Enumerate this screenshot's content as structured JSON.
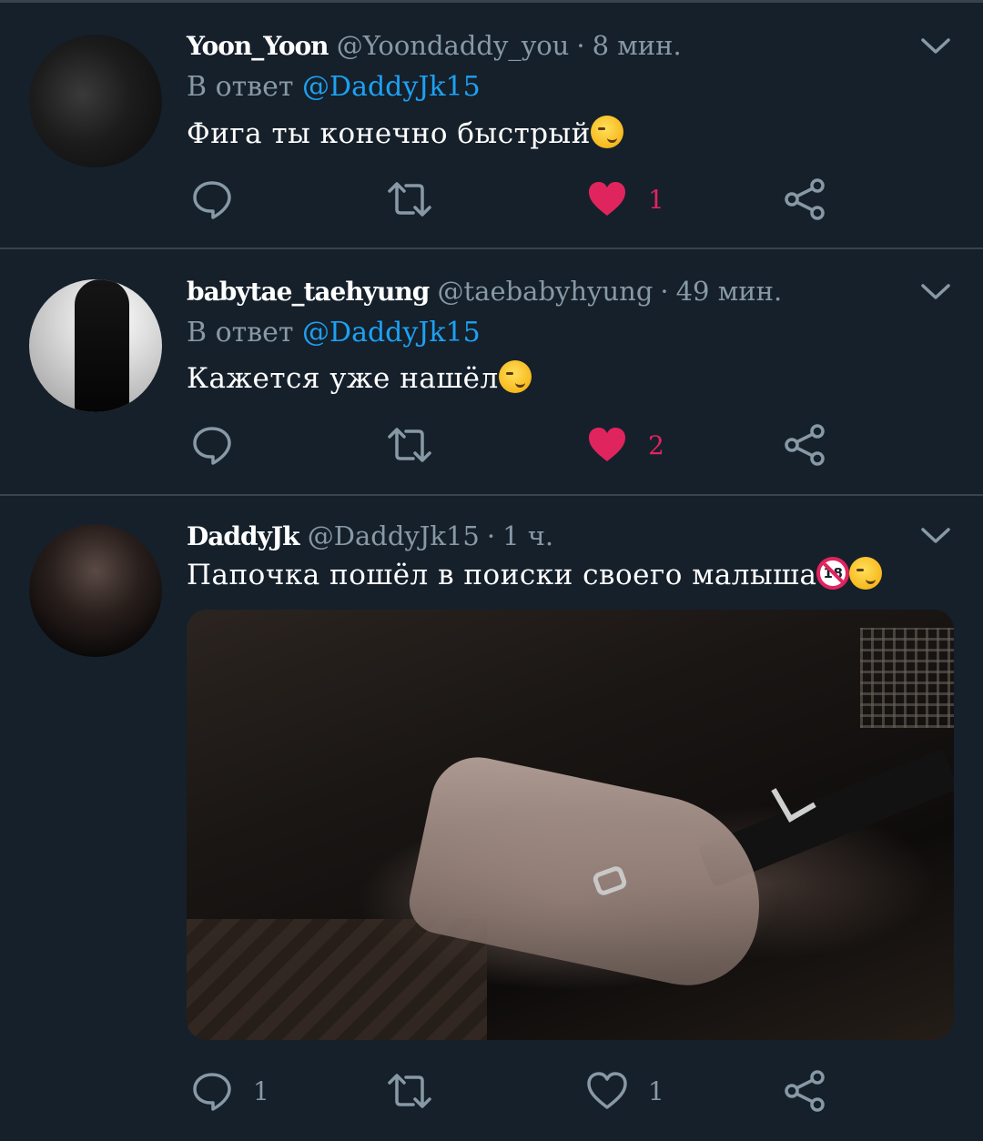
{
  "tweets": [
    {
      "display_name": "Yoon_Yoon",
      "handle": "@Yoondaddy_you",
      "separator": "·",
      "time": "8 мин.",
      "reply_label": "В ответ",
      "reply_to": "@DaddyJk15",
      "text": "Фига ты конечно быстрый",
      "emoji": "smirking-face",
      "reply_count": "",
      "retweet_count": "",
      "like_count": "1",
      "liked": true
    },
    {
      "display_name": "babytae_taehyung",
      "handle": "@taebabyhyung",
      "separator": "·",
      "time": "49 мин.",
      "reply_label": "В ответ",
      "reply_to": "@DaddyJk15",
      "text": "Кажется уже нашёл",
      "emoji": "smirking-face",
      "reply_count": "",
      "retweet_count": "",
      "like_count": "2",
      "liked": true
    },
    {
      "display_name": "DaddyJk",
      "handle": "@DaddyJk15",
      "separator": "·",
      "time": "1 ч.",
      "text": "Папочка пошёл в поиски своего малыша",
      "emoji": [
        "no-one-under-eighteen",
        "smirking-face"
      ],
      "emoji_18_label": "18",
      "has_media": true,
      "reply_count": "1",
      "retweet_count": "",
      "like_count": "1",
      "liked": false
    }
  ],
  "colors": {
    "background": "#15202b",
    "divider": "#38444d",
    "secondary_text": "#8899a6",
    "link": "#1da1f2",
    "like": "#e0245e"
  },
  "icons": {
    "reply": "reply-bubble-icon",
    "retweet": "retweet-icon",
    "like": "heart-icon",
    "share": "share-icon",
    "menu": "chevron-down-icon"
  }
}
